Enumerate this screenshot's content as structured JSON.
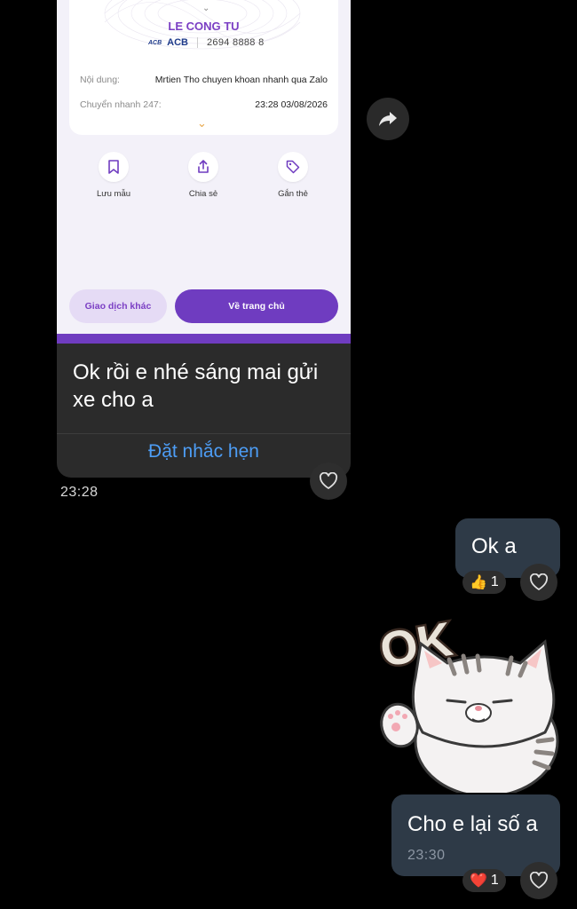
{
  "transfer": {
    "recipient_name": "LE CONG TU",
    "bank_logo": "ACB",
    "bank_name": "ACB",
    "account_number": "2694 8888 8",
    "content_label": "Nội dung:",
    "content_value": "Mrtien Tho chuyen khoan nhanh qua Zalo",
    "fast_label": "Chuyển nhanh 247:",
    "fast_value": "23:28 03/08/2026",
    "actions": [
      {
        "label": "Lưu mẫu",
        "icon": "bookmark-icon"
      },
      {
        "label": "Chia sẻ",
        "icon": "share-icon"
      },
      {
        "label": "Gắn thẻ",
        "icon": "tag-icon"
      }
    ],
    "other_button": "Giao dịch khác",
    "home_button": "Về trang chủ"
  },
  "incoming": {
    "text": "Ok rồi e nhé sáng mai gửi xe cho a",
    "reminder_label": "Đặt nhắc hẹn",
    "time": "23:28"
  },
  "outgoing": [
    {
      "text": "Ok a",
      "reaction_emoji": "👍",
      "reaction_count": "1"
    },
    {
      "text": "Cho e lại số a",
      "time": "23:30",
      "reaction_emoji": "❤️",
      "reaction_count": "1"
    }
  ],
  "sticker": {
    "text": "OK"
  },
  "colors": {
    "purple": "#6f3cc0",
    "link_blue": "#4d9df5",
    "outgoing_bubble": "#2e3a47",
    "incoming_bubble": "#2b2b2b"
  }
}
